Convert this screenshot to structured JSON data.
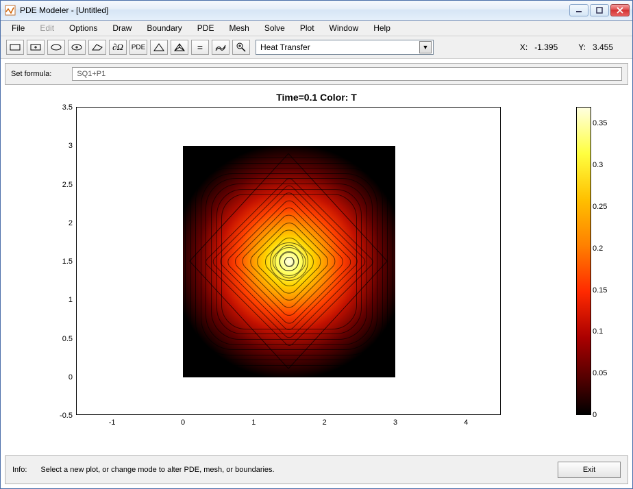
{
  "window": {
    "title": "PDE Modeler - [Untitled]",
    "buttons": {
      "min": "–",
      "max": "▢",
      "close": "✕"
    }
  },
  "menu": {
    "items": [
      "File",
      "Edit",
      "Options",
      "Draw",
      "Boundary",
      "PDE",
      "Mesh",
      "Solve",
      "Plot",
      "Window",
      "Help"
    ],
    "disabled": [
      "Edit"
    ]
  },
  "toolbar": {
    "mode_select": "Heat Transfer",
    "tooltips": {
      "rect": "Rectangle",
      "rect_c": "Rectangle (centered)",
      "ellipse": "Ellipse",
      "ellipse_c": "Ellipse (centered)",
      "polygon": "Polygon",
      "boundary": "Boundary Mode ∂Ω",
      "pde": "PDE Mode",
      "mesh": "Initialize Mesh",
      "refine": "Refine Mesh",
      "solve": "Solve PDE =",
      "plot": "3-D Plot",
      "zoom": "Zoom"
    }
  },
  "coords": {
    "x_label": "X:",
    "x_val": "-1.395",
    "y_label": "Y:",
    "y_val": "3.455"
  },
  "formula": {
    "label": "Set formula:",
    "value": "SQ1+P1"
  },
  "chart_data": {
    "type": "heatmap",
    "title": "Time=0.1   Color: T",
    "xlabel": "",
    "ylabel": "",
    "xlim": [
      -1.5,
      4.5
    ],
    "ylim": [
      -0.5,
      3.5
    ],
    "x_ticks": [
      -1,
      0,
      1,
      2,
      3,
      4
    ],
    "y_ticks": [
      -0.5,
      0,
      0.5,
      1,
      1.5,
      2,
      2.5,
      3,
      3.5
    ],
    "domain_rect": {
      "x0": 0,
      "y0": 0,
      "x1": 3,
      "y1": 3
    },
    "peak": {
      "x": 1.5,
      "y": 1.5,
      "value": 0.37
    },
    "boundary_value": 0.0,
    "colormap": "hot",
    "colorbar": {
      "range": [
        0,
        0.37
      ],
      "ticks": [
        0,
        0.05,
        0.1,
        0.15,
        0.2,
        0.25,
        0.3,
        0.35
      ]
    },
    "contours": {
      "count": 20,
      "shape": "diamond-ish nested around center (1.5,1.5), outer contours rounded-square"
    },
    "geometry_overlay": {
      "square": "SQ1 at [0,3]x[0,3]",
      "polygon": "P1 diamond approx vertices (0.1,1.5),(1.5,2.9),(2.9,1.5),(1.5,0.1)"
    }
  },
  "bottom": {
    "info_label": "Info:",
    "info_text": "Select a new plot, or change mode to alter PDE, mesh, or boundaries.",
    "exit": "Exit"
  }
}
